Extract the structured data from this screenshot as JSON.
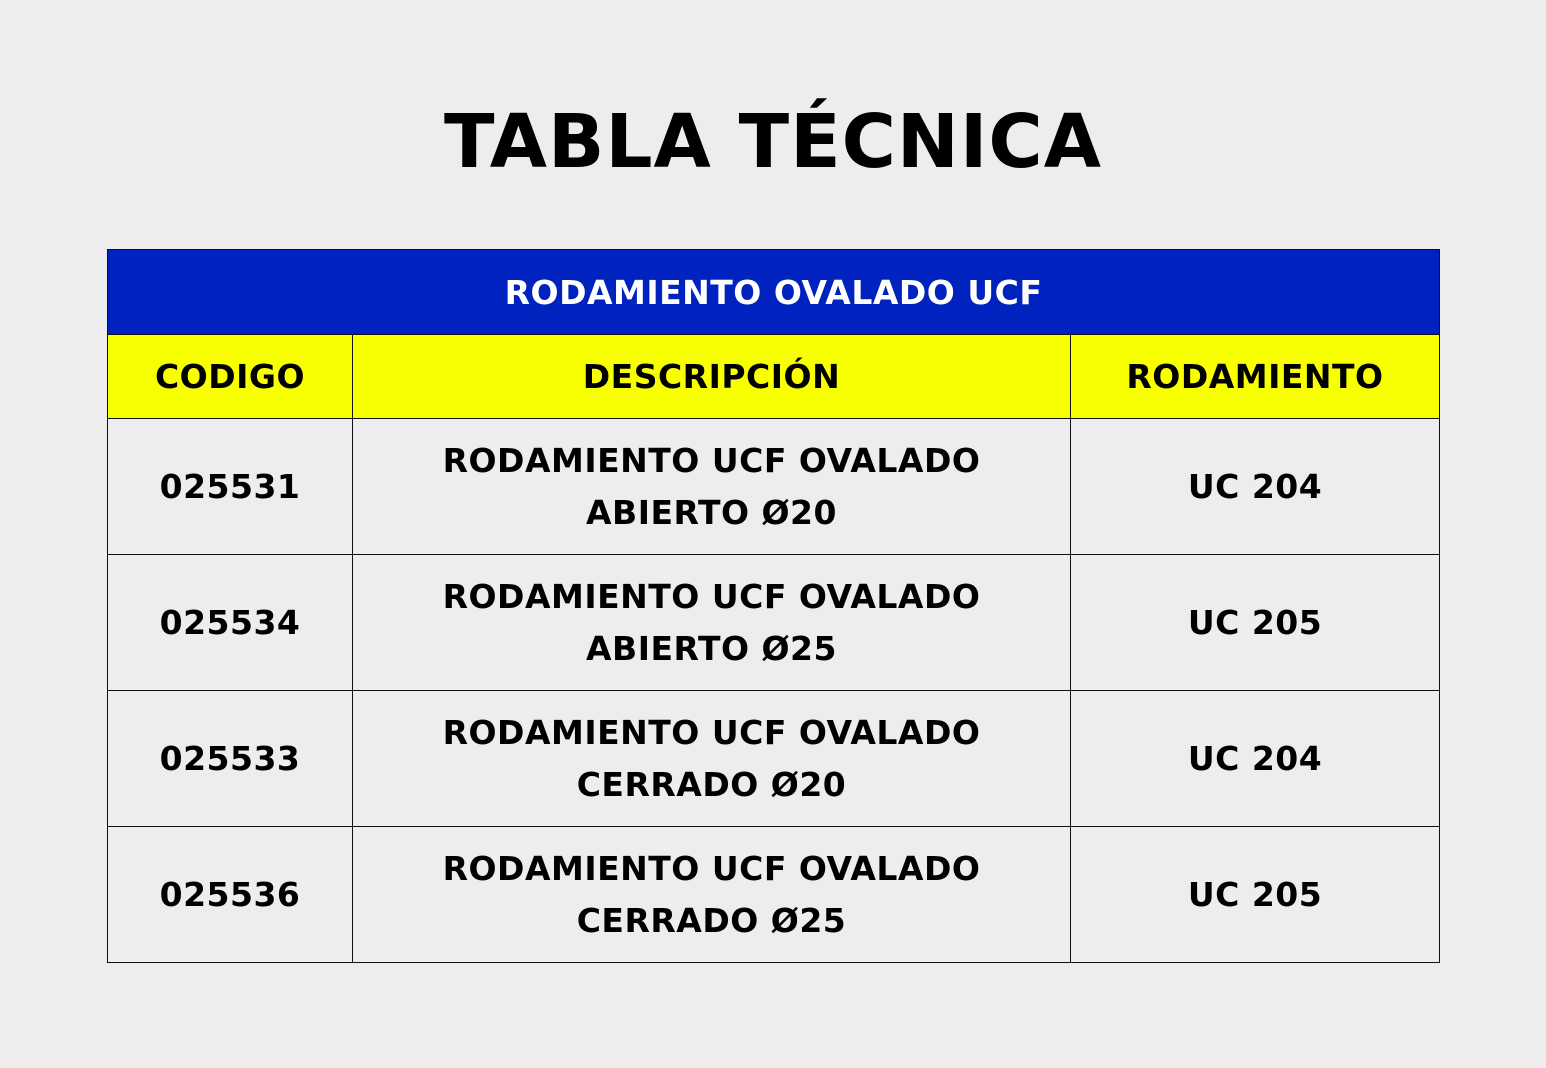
{
  "title": "TABLA TÉCNICA",
  "table": {
    "caption": "RODAMIENTO OVALADO UCF",
    "columns": [
      "CODIGO",
      "DESCRIPCIÓN",
      "RODAMIENTO"
    ],
    "rows": [
      {
        "codigo": "025531",
        "descripcion": [
          "RODAMIENTO UCF OVALADO",
          "ABIERTO Ø20"
        ],
        "rodamiento": "UC 204"
      },
      {
        "codigo": "025534",
        "descripcion": [
          "RODAMIENTO UCF OVALADO",
          "ABIERTO Ø25"
        ],
        "rodamiento": "UC 205"
      },
      {
        "codigo": "025533",
        "descripcion": [
          "RODAMIENTO UCF OVALADO",
          "CERRADO Ø20"
        ],
        "rodamiento": "UC 204"
      },
      {
        "codigo": "025536",
        "descripcion": [
          "RODAMIENTO UCF OVALADO",
          "CERRADO Ø25"
        ],
        "rodamiento": "UC 205"
      }
    ]
  },
  "colors": {
    "background": "#ededed",
    "caption_bg": "#0022be",
    "caption_text": "#ffffff",
    "header_bg": "#f8ff00",
    "border": "#111111"
  }
}
